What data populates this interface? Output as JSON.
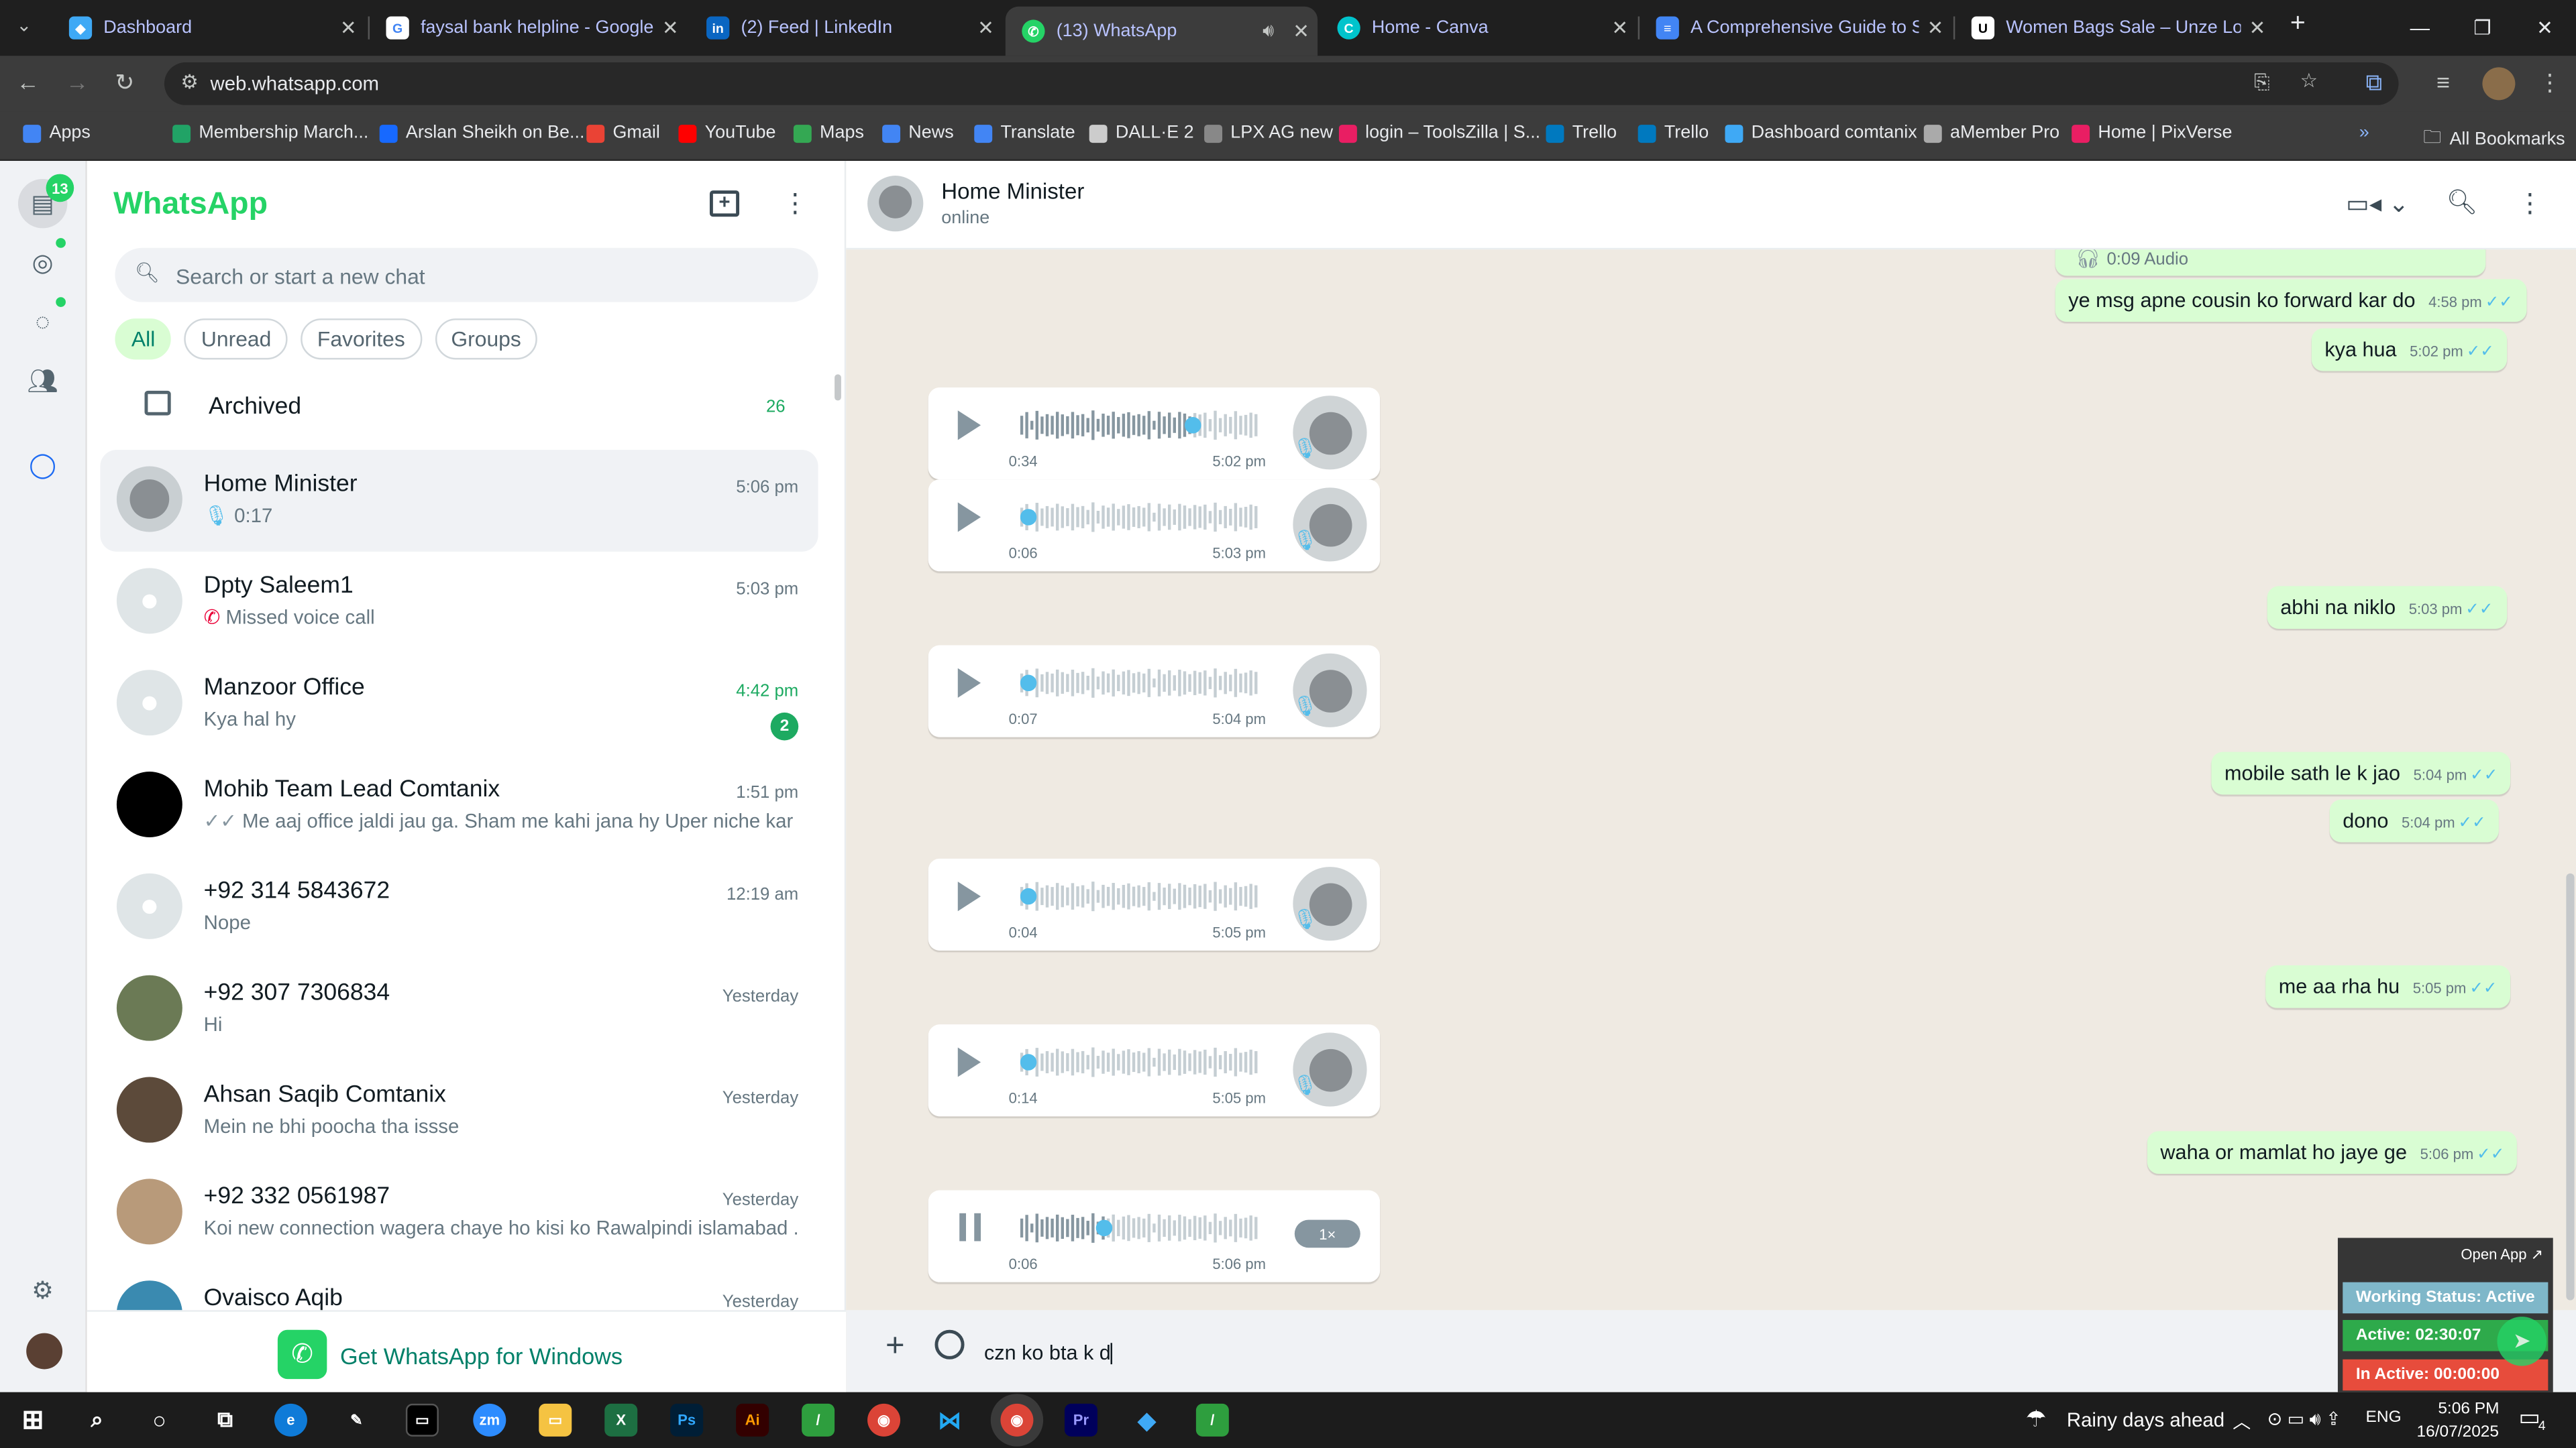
{
  "browser": {
    "tabs": [
      {
        "title": "Dashboard"
      },
      {
        "title": "faysal bank helpline - Google S"
      },
      {
        "title": "(2) Feed | LinkedIn"
      },
      {
        "title": "(13) WhatsApp"
      },
      {
        "title": "Home - Canva"
      },
      {
        "title": "A Comprehensive Guide to Stra"
      },
      {
        "title": "Women Bags Sale – Unze Lond"
      }
    ],
    "url": "web.whatsapp.com",
    "bookmarks": [
      {
        "label": "Apps",
        "color": "#4285f4"
      },
      {
        "label": "Membership March...",
        "color": "#21a366"
      },
      {
        "label": "Arslan Sheikh on Be...",
        "color": "#1769ff"
      },
      {
        "label": "Gmail",
        "color": "#ea4335"
      },
      {
        "label": "YouTube",
        "color": "#ff0000"
      },
      {
        "label": "Maps",
        "color": "#34a853"
      },
      {
        "label": "News",
        "color": "#4285f4"
      },
      {
        "label": "Translate",
        "color": "#4285f4"
      },
      {
        "label": "DALL·E 2",
        "color": "#cccccc"
      },
      {
        "label": "LPX AG new",
        "color": "#888888"
      },
      {
        "label": "login – ToolsZilla | S...",
        "color": "#e91e63"
      },
      {
        "label": "Trello",
        "color": "#0079bf"
      },
      {
        "label": "Trello",
        "color": "#0079bf"
      },
      {
        "label": "Dashboard comtanix",
        "color": "#3fa9f5"
      },
      {
        "label": "aMember Pro",
        "color": "#aaaaaa"
      },
      {
        "label": "Home | PixVerse",
        "color": "#e91e63"
      }
    ],
    "all_bookmarks": "All Bookmarks",
    "more_bookmarks": "»"
  },
  "whatsapp": {
    "brand": "WhatsApp",
    "unread_badge": "13",
    "search_placeholder": "Search or start a new chat",
    "filters": [
      "All",
      "Unread",
      "Favorites",
      "Groups"
    ],
    "archived": {
      "label": "Archived",
      "count": "26"
    },
    "chats": [
      {
        "name": "Home Minister",
        "msg": "0:17",
        "time": "5:06 pm",
        "kind": "voice"
      },
      {
        "name": "Dpty Saleem1",
        "msg": "Missed voice call",
        "time": "5:03 pm",
        "kind": "missed"
      },
      {
        "name": "Manzoor Office",
        "msg": "Kya hal hy",
        "time": "4:42 pm",
        "unread": "2"
      },
      {
        "name": "Mohib Team Lead Comtanix",
        "msg": "Me aaj office jaldi jau ga.  Sham me kahi jana hy  Uper niche kar k...",
        "time": "1:51 pm",
        "kind": "read"
      },
      {
        "name": "+92 314 5843672",
        "msg": "Nope",
        "time": "12:19 am"
      },
      {
        "name": "+92 307 7306834",
        "msg": "Hi",
        "time": "Yesterday"
      },
      {
        "name": "Ahsan Saqib Comtanix",
        "msg": "Mein ne bhi poocha tha issse",
        "time": "Yesterday"
      },
      {
        "name": "+92 332 0561987",
        "msg": "Koi new connection wagera chaye ho kisi ko Rawalpindi islamabad ...",
        "time": "Yesterday"
      },
      {
        "name": "Ovaisco Aqib",
        "msg": "",
        "time": "Yesterday"
      }
    ],
    "get_windows": "Get WhatsApp for Windows",
    "contact": {
      "name": "Home Minister",
      "status": "online"
    },
    "messages": {
      "audio_label": "0:09 Audio",
      "out1": {
        "text": "ye msg apne cousin ko forward kar do",
        "time": "4:58 pm"
      },
      "out2": {
        "text": "kya hua",
        "time": "5:02 pm"
      },
      "voice1": {
        "dur": "0:34",
        "time": "5:02 pm",
        "progress": 0.72
      },
      "voice2": {
        "dur": "0:06",
        "time": "5:03 pm",
        "progress": 0
      },
      "out3": {
        "text": "abhi na niklo",
        "time": "5:03 pm"
      },
      "voice3": {
        "dur": "0:07",
        "time": "5:04 pm",
        "progress": 0
      },
      "out4": {
        "text": "mobile sath le k jao",
        "time": "5:04 pm"
      },
      "out5": {
        "text": "dono",
        "time": "5:04 pm"
      },
      "voice4": {
        "dur": "0:04",
        "time": "5:05 pm",
        "progress": 0
      },
      "out6": {
        "text": "me aa rha hu",
        "time": "5:05 pm"
      },
      "voice5": {
        "dur": "0:14",
        "time": "5:05 pm",
        "progress": 0
      },
      "out7": {
        "text": "waha or mamlat ho jaye ge",
        "time": "5:06 pm"
      },
      "voice6": {
        "dur": "0:06",
        "time": "5:06 pm",
        "progress": 0.35,
        "speed": "1×"
      }
    },
    "composer_text": "czn ko bta k d"
  },
  "extension": {
    "open_app": "Open App ↗",
    "working": "Working Status: Active",
    "active": "Active: 02:30:07",
    "inactive": "In Active: 00:00:00",
    "colors": {
      "working": "#7fb7c9",
      "active": "#2eaa4b",
      "inactive": "#e74c3c"
    }
  },
  "taskbar": {
    "weather": "Rainy days ahead",
    "lang": "ENG",
    "time": "5:06 PM",
    "date": "16/07/2025",
    "notif": "4"
  }
}
